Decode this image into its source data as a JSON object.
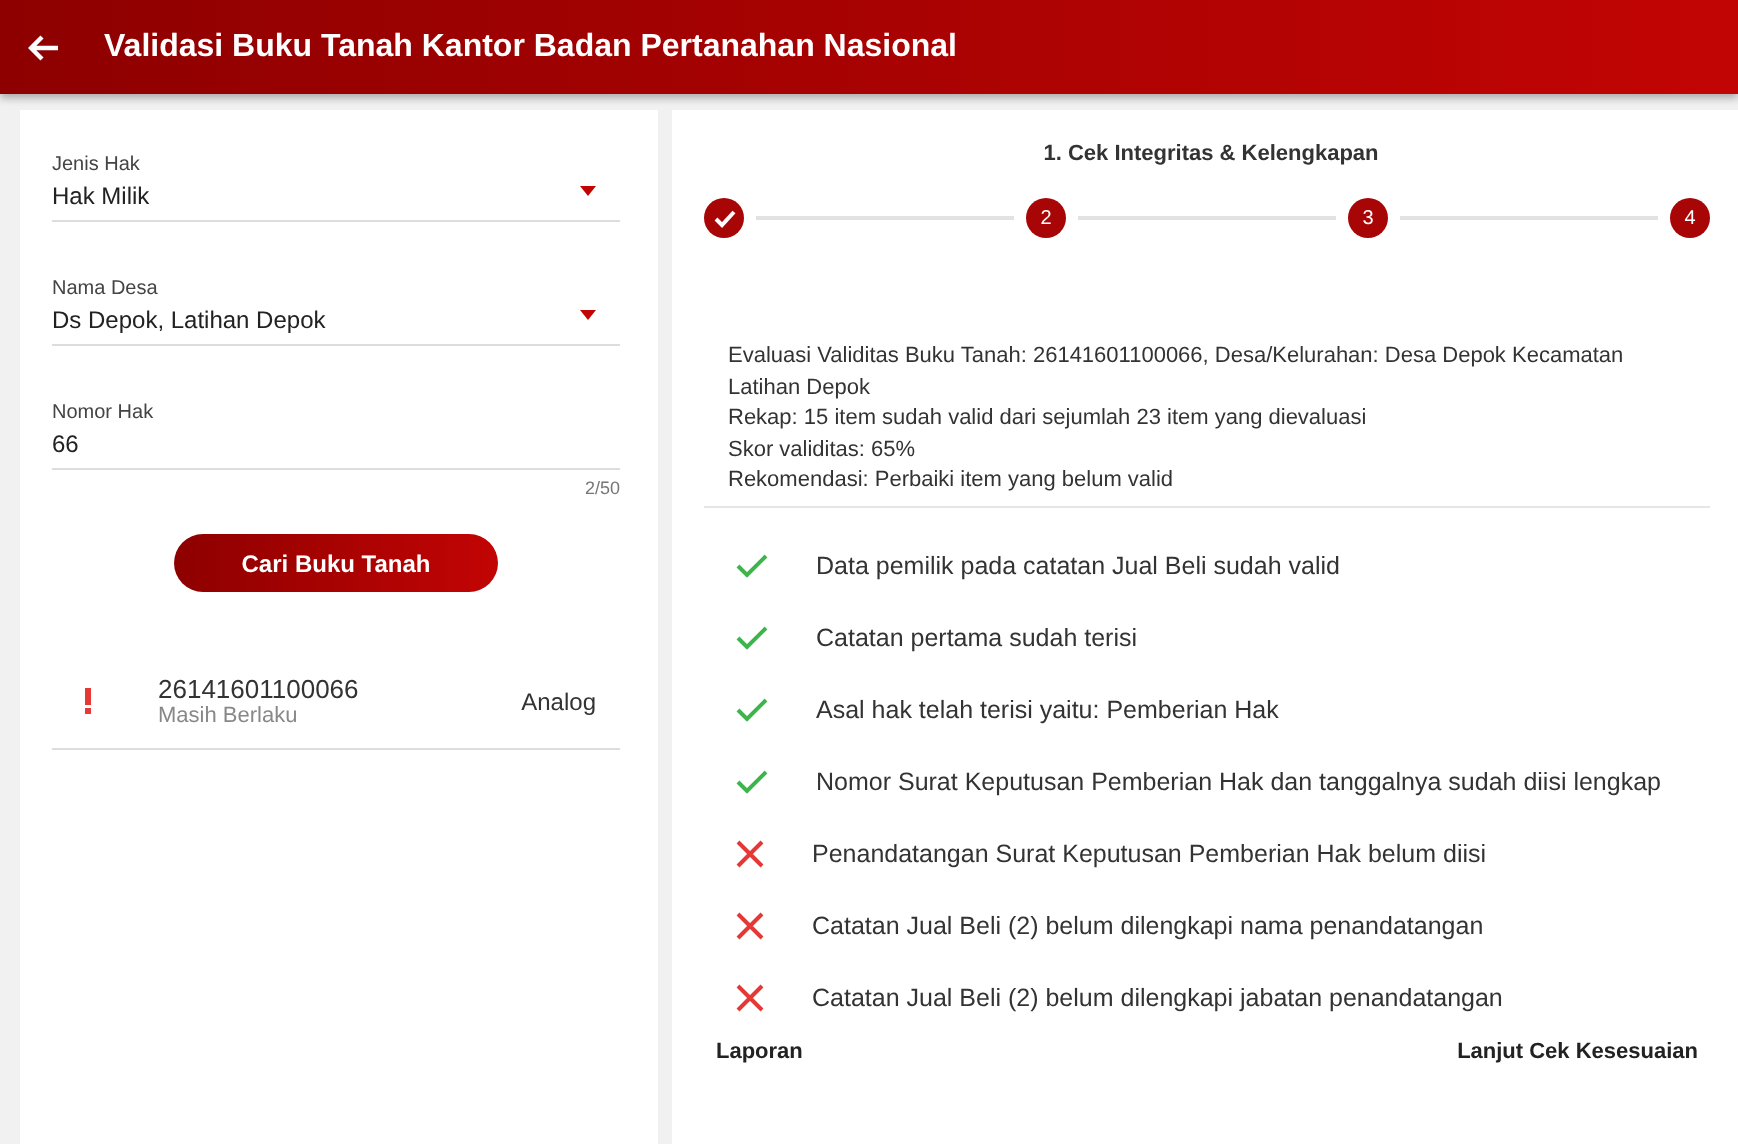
{
  "header": {
    "title": "Validasi Buku Tanah Kantor Badan Pertanahan Nasional"
  },
  "form": {
    "fields": [
      {
        "kind": "select",
        "label": "Jenis Hak",
        "value": "Hak Milik"
      },
      {
        "kind": "select",
        "label": "Nama Desa",
        "value": "Ds Depok, Latihan Depok"
      },
      {
        "kind": "text",
        "label": "Nomor Hak",
        "value": "66",
        "counter": "2/50"
      }
    ],
    "button": "Cari Buku Tanah",
    "results": [
      {
        "warning": true,
        "number": "26141601100066",
        "status": "Masih Berlaku",
        "type": "Analog"
      }
    ]
  },
  "stepper": {
    "title": "1. Cek Integritas & Kelengkapan",
    "steps": [
      {
        "done": true
      },
      {
        "label": "2",
        "done": false
      },
      {
        "label": "3",
        "done": false
      },
      {
        "label": "4",
        "done": false
      }
    ]
  },
  "summary": [
    "Evaluasi Validitas Buku Tanah: 26141601100066, Desa/Kelurahan: Desa Depok Kecamatan Latihan Depok",
    "Rekap: 15 item sudah valid dari sejumlah 23 item yang dievaluasi",
    "Skor validitas: 65%",
    "Rekomendasi: Perbaiki item yang belum valid"
  ],
  "checks": [
    {
      "kind": "pass",
      "text": "Data pemilik pada catatan Jual Beli sudah valid"
    },
    {
      "kind": "pass",
      "text": "Catatan pertama sudah terisi"
    },
    {
      "kind": "pass",
      "text": "Asal hak telah terisi yaitu: Pemberian Hak"
    },
    {
      "kind": "pass",
      "text": "Nomor Surat Keputusan Pemberian Hak dan tanggalnya sudah diisi lengkap"
    },
    {
      "kind": "fail",
      "text": "Penandatangan Surat Keputusan Pemberian Hak belum diisi"
    },
    {
      "kind": "fail",
      "text": "Catatan Jual Beli (2) belum dilengkapi nama penandatangan"
    },
    {
      "kind": "fail",
      "text": "Catatan Jual Beli (2) belum dilengkapi jabatan penandatangan"
    }
  ],
  "actions": {
    "left": "Laporan",
    "right": "Lanjut Cek Kesesuaian"
  }
}
